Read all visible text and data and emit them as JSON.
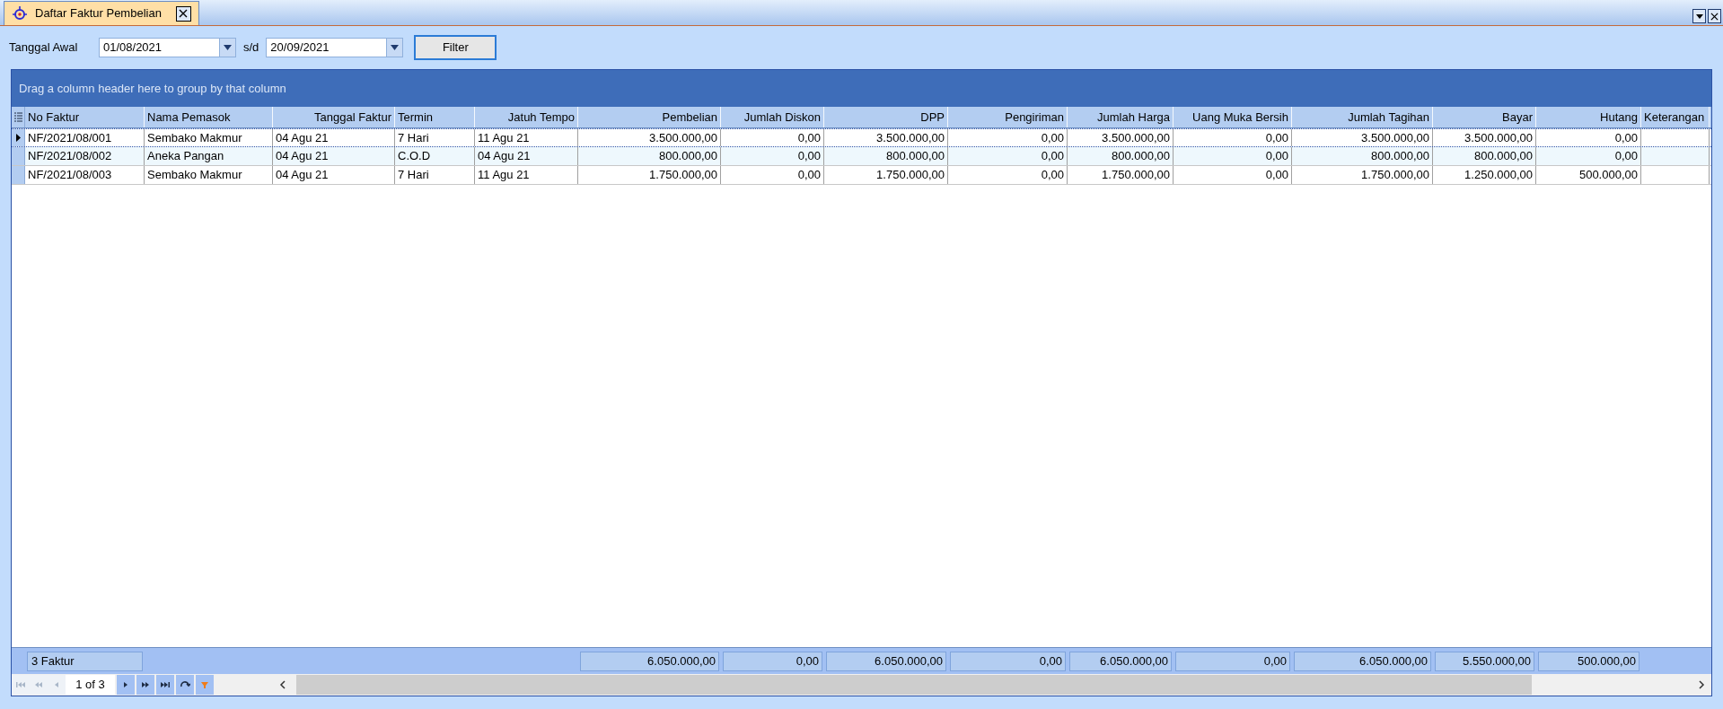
{
  "tab": {
    "title": "Daftar Faktur Pembelian",
    "selected": true
  },
  "filter": {
    "label": "Tanggal Awal",
    "start": "01/08/2021",
    "separator": "s/d",
    "end": "20/09/2021",
    "button": "Filter"
  },
  "grid": {
    "group_hint": "Drag a column header here to group by that column",
    "columns": [
      "No Faktur",
      "Nama Pemasok",
      "Tanggal Faktur",
      "Termin",
      "Jatuh Tempo",
      "Pembelian",
      "Jumlah Diskon",
      "DPP",
      "Pengiriman",
      "Jumlah Harga",
      "Uang Muka Bersih",
      "Jumlah Tagihan",
      "Bayar",
      "Hutang",
      "Keterangan"
    ],
    "rows": [
      {
        "selected": true,
        "cells": [
          "NF/2021/08/001",
          "Sembako Makmur",
          "04 Agu 21",
          "7 Hari",
          "11 Agu 21",
          "3.500.000,00",
          "0,00",
          "3.500.000,00",
          "0,00",
          "3.500.000,00",
          "0,00",
          "3.500.000,00",
          "3.500.000,00",
          "0,00"
        ]
      },
      {
        "selected": false,
        "cells": [
          "NF/2021/08/002",
          "Aneka Pangan",
          "04 Agu 21",
          "C.O.D",
          "04 Agu 21",
          "800.000,00",
          "0,00",
          "800.000,00",
          "0,00",
          "800.000,00",
          "0,00",
          "800.000,00",
          "800.000,00",
          "0,00"
        ]
      },
      {
        "selected": false,
        "cells": [
          "NF/2021/08/003",
          "Sembako Makmur",
          "04 Agu 21",
          "7 Hari",
          "11 Agu 21",
          "1.750.000,00",
          "0,00",
          "1.750.000,00",
          "0,00",
          "1.750.000,00",
          "0,00",
          "1.750.000,00",
          "1.250.000,00",
          "500.000,00"
        ]
      }
    ],
    "summary": {
      "count": "3 Faktur",
      "totals": [
        "6.050.000,00",
        "0,00",
        "6.050.000,00",
        "0,00",
        "6.050.000,00",
        "0,00",
        "6.050.000,00",
        "5.550.000,00",
        "500.000,00"
      ]
    },
    "pager": {
      "page": "1 of 3",
      "buttons": [
        {
          "kind": "first",
          "disabled": true
        },
        {
          "kind": "prev-page",
          "disabled": true
        },
        {
          "kind": "prev",
          "disabled": true
        },
        {
          "kind": "next",
          "disabled": false
        },
        {
          "kind": "next-page",
          "disabled": false
        },
        {
          "kind": "last",
          "disabled": false
        },
        {
          "kind": "refresh",
          "disabled": false
        },
        {
          "kind": "filter",
          "disabled": false
        }
      ]
    }
  }
}
